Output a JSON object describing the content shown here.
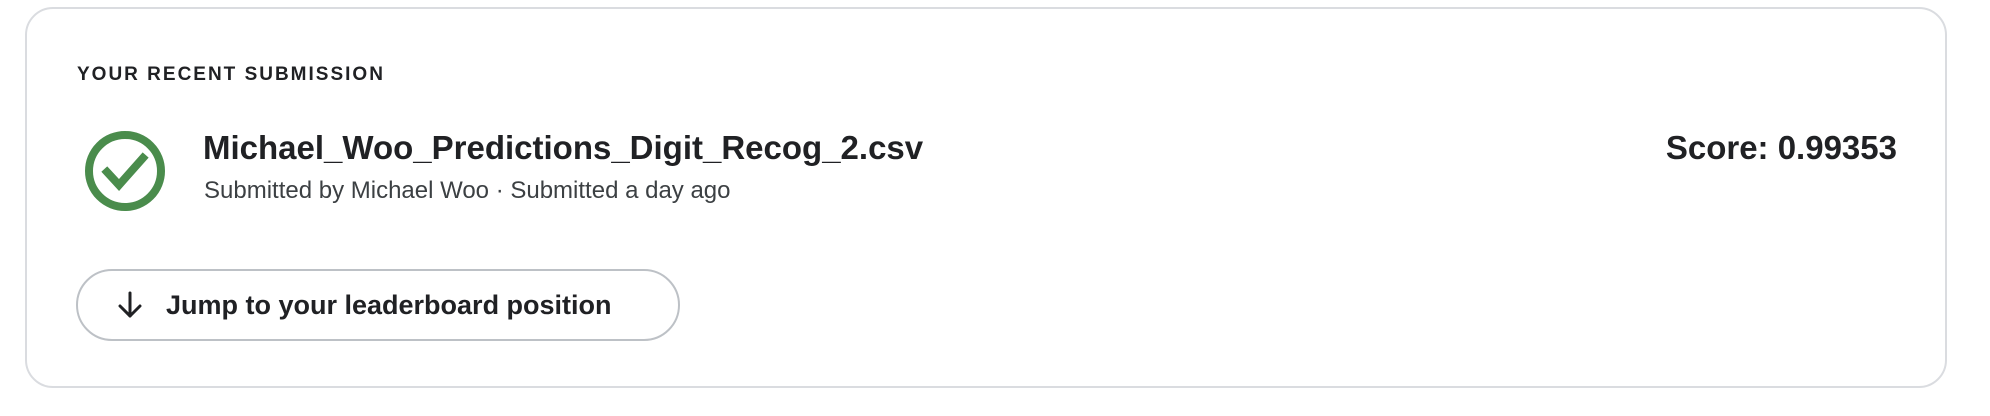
{
  "submission": {
    "section_label": "YOUR RECENT SUBMISSION",
    "status_icon": "check-circle-icon",
    "status_color": "#4a8c4c",
    "file_name": "Michael_Woo_Predictions_Digit_Recog_2.csv",
    "meta": "Submitted by Michael Woo · Submitted a day ago",
    "score": "Score: 0.99353"
  },
  "actions": {
    "jump_icon": "arrow-down-icon",
    "jump_label": "Jump to your leaderboard position"
  }
}
